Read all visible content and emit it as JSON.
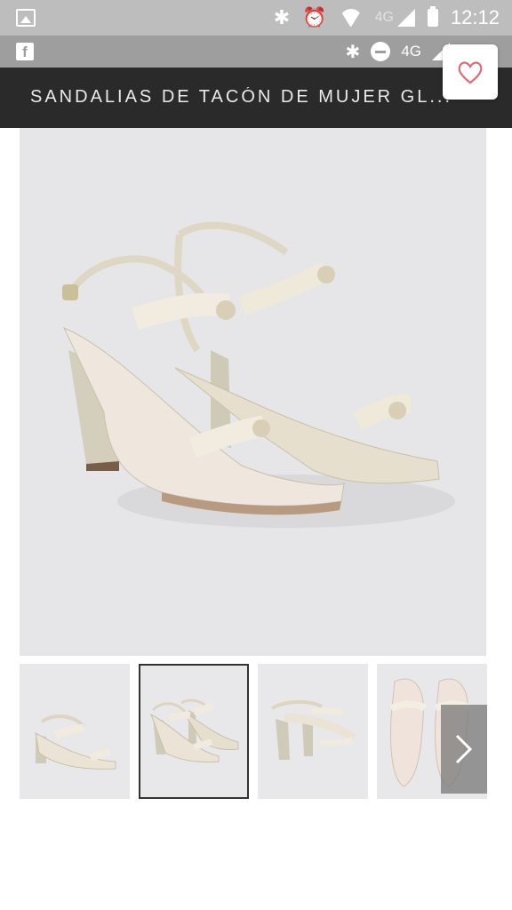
{
  "status_bar": {
    "network_label": "4G",
    "time": "12:12"
  },
  "secondary_bar": {
    "network_label": "4G",
    "brand_icon": "facebook-icon",
    "brand_glyph": "f"
  },
  "header": {
    "title": "SANDALIAS DE TACÓN DE MUJER GL..."
  },
  "favorite": {
    "icon": "heart-icon",
    "color": "#e06b76"
  },
  "gallery": {
    "thumbnails": [
      {
        "view": "side",
        "selected": false
      },
      {
        "view": "pair",
        "selected": true
      },
      {
        "view": "front",
        "selected": false
      },
      {
        "view": "top",
        "selected": false
      }
    ],
    "next_icon": "chevron-right-icon"
  }
}
